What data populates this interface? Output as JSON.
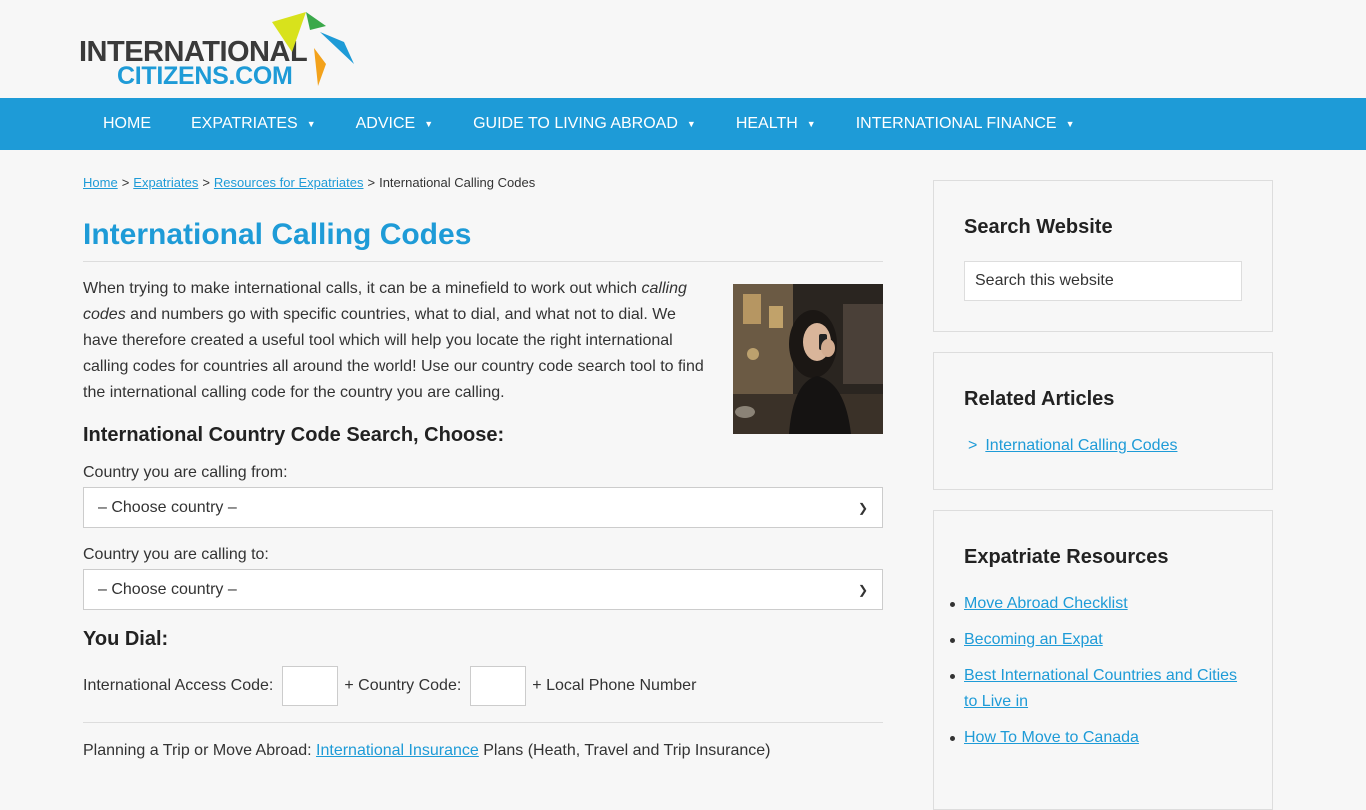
{
  "logo": {
    "line1": "INTERNATIONAL",
    "line2": "CITIZENS.COM"
  },
  "nav": {
    "items": [
      {
        "label": "HOME",
        "has_caret": false
      },
      {
        "label": "EXPATRIATES",
        "has_caret": true
      },
      {
        "label": "ADVICE",
        "has_caret": true
      },
      {
        "label": "GUIDE TO LIVING ABROAD",
        "has_caret": true
      },
      {
        "label": "HEALTH",
        "has_caret": true
      },
      {
        "label": "INTERNATIONAL FINANCE",
        "has_caret": true
      }
    ],
    "caret_glyph": "▼"
  },
  "breadcrumb": {
    "home": "Home",
    "expatriates": "Expatriates",
    "resources": "Resources for Expatriates",
    "current": "International Calling Codes",
    "sep": ">"
  },
  "page": {
    "title": "International Calling Codes",
    "intro_1": "When trying to make international calls, it can be a minefield to work out which ",
    "intro_em": "calling codes",
    "intro_2": " and numbers go with specific countries, what to dial, and what not to dial. We have therefore created a useful tool which will help you locate the right international calling codes for countries all around the world! Use our country code search tool to find the international calling code for the country you are calling.",
    "search_heading": "International Country Code Search, Choose:",
    "from_label": "Country you are calling from:",
    "from_value": "– Choose country –",
    "to_label": "Country you are calling to:",
    "to_value": "– Choose country –",
    "dial_heading": "You Dial:",
    "access_label": "International Access Code:",
    "country_label": "+ Country Code:",
    "local_label": "+ Local Phone Number",
    "plan_prefix": "Planning a Trip or Move Abroad: ",
    "plan_link": "International Insurance",
    "plan_suffix": " Plans (Heath, Travel and Trip Insurance)"
  },
  "sidebar": {
    "search_title": "Search Website",
    "search_placeholder": "Search this website",
    "related_title": "Related Articles",
    "related_items": [
      "International Calling Codes"
    ],
    "related_marker": ">",
    "resources_title": "Expatriate Resources",
    "resources_items": [
      "Move Abroad Checklist",
      "Becoming an Expat",
      "Best International Countries and Cities to Live in",
      "How To Move to Canada"
    ]
  },
  "colors": {
    "accent": "#1e9bd7",
    "nav_bg": "#1e9bd7",
    "page_bg": "#f7f7f7"
  }
}
